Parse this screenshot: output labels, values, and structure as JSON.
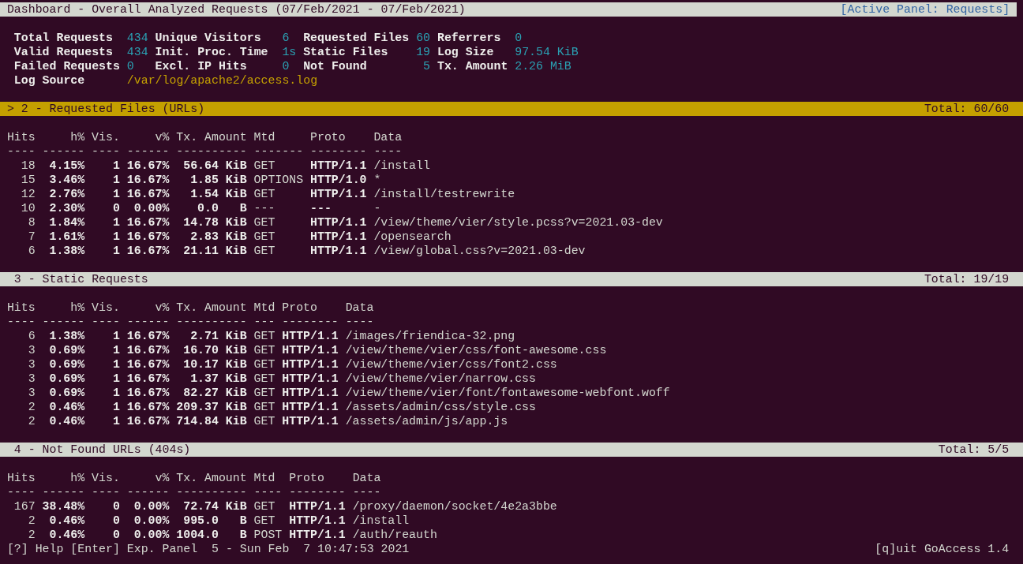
{
  "title_bar": {
    "title": "Dashboard - Overall Analyzed Requests (07/Feb/2021 - 07/Feb/2021)",
    "active_panel": "[Active Panel: Requests]"
  },
  "stats": [
    [
      {
        "label": "Total Requests",
        "value": "434",
        "kind": "metric"
      },
      {
        "label": "Unique Visitors",
        "value": "6",
        "kind": "metric"
      },
      {
        "label": "Requested Files",
        "value": "60",
        "kind": "metric"
      },
      {
        "label": "Referrers",
        "value": "0",
        "kind": "metric"
      }
    ],
    [
      {
        "label": "Valid Requests",
        "value": "434",
        "kind": "metric"
      },
      {
        "label": "Init. Proc. Time",
        "value": "1s",
        "kind": "metric"
      },
      {
        "label": "Static Files",
        "value": "19",
        "kind": "metric"
      },
      {
        "label": "Log Size",
        "value": "97.54 KiB",
        "kind": "metric"
      }
    ],
    [
      {
        "label": "Failed Requests",
        "value": "0",
        "kind": "metric"
      },
      {
        "label": "Excl. IP Hits",
        "value": "0",
        "kind": "metric"
      },
      {
        "label": "Not Found",
        "value": "5",
        "kind": "metric"
      },
      {
        "label": "Tx. Amount",
        "value": "2.26 MiB",
        "kind": "metric"
      }
    ],
    [
      {
        "label": "Log Source",
        "value": "/var/log/apache2/access.log",
        "kind": "path"
      }
    ]
  ],
  "panels": [
    {
      "title": "> 2 - Requested Files (URLs)",
      "total": "Total: 60/60",
      "selected": true,
      "columns": [
        {
          "label": "Hits",
          "rule": "----"
        },
        {
          "label": "h%",
          "rule": "------"
        },
        {
          "label": "Vis.",
          "rule": "----"
        },
        {
          "label": "v%",
          "rule": "------"
        },
        {
          "label": "Tx. Amount",
          "rule": "----------"
        },
        {
          "label": "Mtd",
          "rule": "-------"
        },
        {
          "label": "Proto",
          "rule": "--------"
        },
        {
          "label": "Data",
          "rule": "----"
        }
      ],
      "rows": [
        [
          "18",
          "4.15%",
          "1",
          "16.67%",
          "56.64 KiB",
          "GET",
          "HTTP/1.1",
          "/install"
        ],
        [
          "15",
          "3.46%",
          "1",
          "16.67%",
          "1.85 KiB",
          "OPTIONS",
          "HTTP/1.0",
          "*"
        ],
        [
          "12",
          "2.76%",
          "1",
          "16.67%",
          "1.54 KiB",
          "GET",
          "HTTP/1.1",
          "/install/testrewrite"
        ],
        [
          "10",
          "2.30%",
          "0",
          "0.00%",
          "0.0   B",
          "---",
          "---",
          "-"
        ],
        [
          "8",
          "1.84%",
          "1",
          "16.67%",
          "14.78 KiB",
          "GET",
          "HTTP/1.1",
          "/view/theme/vier/style.pcss?v=2021.03-dev"
        ],
        [
          "7",
          "1.61%",
          "1",
          "16.67%",
          "2.83 KiB",
          "GET",
          "HTTP/1.1",
          "/opensearch"
        ],
        [
          "6",
          "1.38%",
          "1",
          "16.67%",
          "21.11 KiB",
          "GET",
          "HTTP/1.1",
          "/view/global.css?v=2021.03-dev"
        ]
      ]
    },
    {
      "title": "3 - Static Requests",
      "total": "Total: 19/19",
      "selected": false,
      "columns": [
        {
          "label": "Hits",
          "rule": "----"
        },
        {
          "label": "h%",
          "rule": "------"
        },
        {
          "label": "Vis.",
          "rule": "----"
        },
        {
          "label": "v%",
          "rule": "------"
        },
        {
          "label": "Tx. Amount",
          "rule": "----------"
        },
        {
          "label": "Mtd",
          "rule": "---"
        },
        {
          "label": "Proto",
          "rule": "--------"
        },
        {
          "label": "Data",
          "rule": "----"
        }
      ],
      "rows": [
        [
          "6",
          "1.38%",
          "1",
          "16.67%",
          "2.71 KiB",
          "GET",
          "HTTP/1.1",
          "/images/friendica-32.png"
        ],
        [
          "3",
          "0.69%",
          "1",
          "16.67%",
          "16.70 KiB",
          "GET",
          "HTTP/1.1",
          "/view/theme/vier/css/font-awesome.css"
        ],
        [
          "3",
          "0.69%",
          "1",
          "16.67%",
          "10.17 KiB",
          "GET",
          "HTTP/1.1",
          "/view/theme/vier/css/font2.css"
        ],
        [
          "3",
          "0.69%",
          "1",
          "16.67%",
          "1.37 KiB",
          "GET",
          "HTTP/1.1",
          "/view/theme/vier/narrow.css"
        ],
        [
          "3",
          "0.69%",
          "1",
          "16.67%",
          "82.27 KiB",
          "GET",
          "HTTP/1.1",
          "/view/theme/vier/font/fontawesome-webfont.woff"
        ],
        [
          "2",
          "0.46%",
          "1",
          "16.67%",
          "209.37 KiB",
          "GET",
          "HTTP/1.1",
          "/assets/admin/css/style.css"
        ],
        [
          "2",
          "0.46%",
          "1",
          "16.67%",
          "714.84 KiB",
          "GET",
          "HTTP/1.1",
          "/assets/admin/js/app.js"
        ]
      ]
    },
    {
      "title": "4 - Not Found URLs (404s)",
      "total": "Total: 5/5",
      "selected": false,
      "columns": [
        {
          "label": "Hits",
          "rule": "----"
        },
        {
          "label": "h%",
          "rule": "------"
        },
        {
          "label": "Vis.",
          "rule": "----"
        },
        {
          "label": "v%",
          "rule": "------"
        },
        {
          "label": "Tx. Amount",
          "rule": "----------"
        },
        {
          "label": "Mtd",
          "rule": "----"
        },
        {
          "label": "Proto",
          "rule": "--------"
        },
        {
          "label": "Data",
          "rule": "----"
        }
      ],
      "rows": [
        [
          "167",
          "38.48%",
          "0",
          "0.00%",
          "72.74 KiB",
          "GET",
          "HTTP/1.1",
          "/proxy/daemon/socket/4e2a3bbe"
        ],
        [
          "2",
          "0.46%",
          "0",
          "0.00%",
          "995.0   B",
          "GET",
          "HTTP/1.1",
          "/install"
        ],
        [
          "2",
          "0.46%",
          "0",
          "0.00%",
          "1004.0   B",
          "POST",
          "HTTP/1.1",
          "/auth/reauth"
        ]
      ]
    }
  ],
  "status_bar": {
    "left": "[?] Help [Enter] Exp. Panel  5 - Sun Feb  7 10:47:53 2021",
    "right": "[q]uit GoAccess 1.4"
  }
}
